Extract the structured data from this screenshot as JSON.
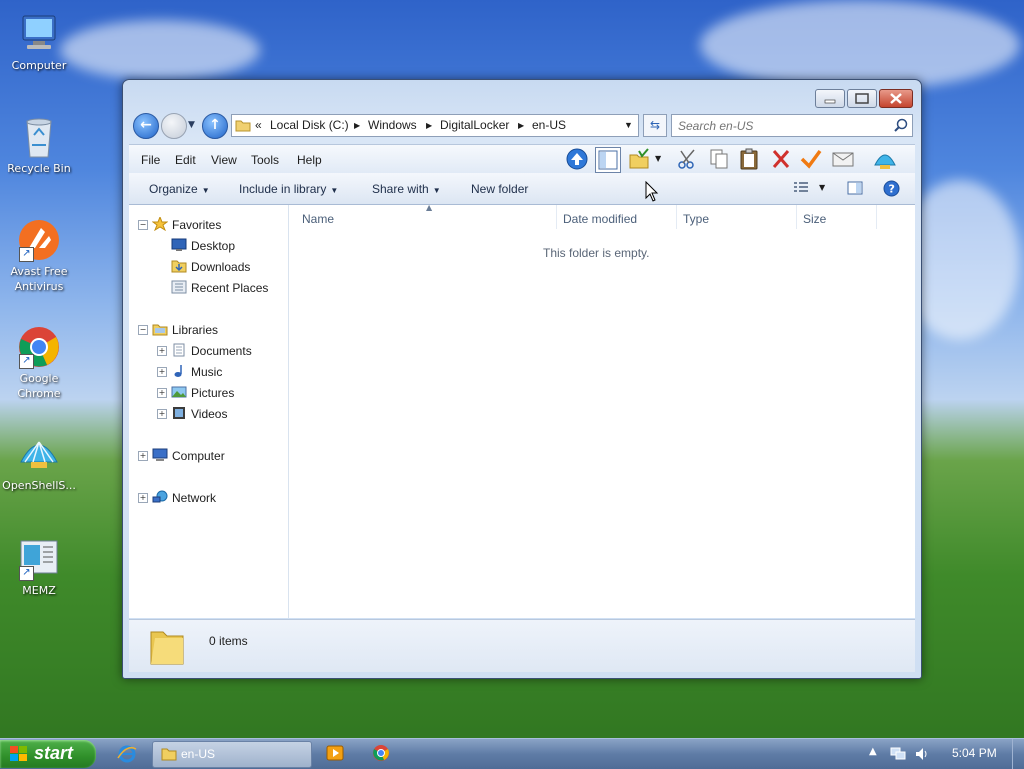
{
  "desktop": {
    "icons": [
      {
        "label": "Computer"
      },
      {
        "label": "Recycle Bin"
      },
      {
        "label": "Avast Free Antivirus"
      },
      {
        "label": "Google Chrome"
      },
      {
        "label": "OpenShellS..."
      },
      {
        "label": "MEMZ"
      }
    ]
  },
  "window": {
    "address": {
      "overflow": "«",
      "segments": [
        "Local Disk (C:)",
        "Windows",
        "DigitalLocker",
        "en-US"
      ]
    },
    "search": {
      "placeholder": "Search en-US"
    },
    "menu": [
      "File",
      "Edit",
      "View",
      "Tools",
      "Help"
    ],
    "commands": {
      "organize": "Organize",
      "include_in_library": "Include in library",
      "share_with": "Share with",
      "new_folder": "New folder"
    },
    "nav": {
      "favorites": "Favorites",
      "desktop": "Desktop",
      "downloads": "Downloads",
      "recent_places": "Recent Places",
      "libraries": "Libraries",
      "documents": "Documents",
      "music": "Music",
      "pictures": "Pictures",
      "videos": "Videos",
      "computer": "Computer",
      "network": "Network"
    },
    "columns": [
      "Name",
      "Date modified",
      "Type",
      "Size"
    ],
    "empty_message": "This folder is empty.",
    "details": {
      "item_count": "0 items"
    }
  },
  "taskbar": {
    "start_label": "start",
    "active_window": "en-US",
    "clock": "5:04 PM"
  },
  "colors": {
    "accent": "#1f63c8",
    "start_green": "#2f8f2a",
    "close_red": "#c4452f"
  }
}
